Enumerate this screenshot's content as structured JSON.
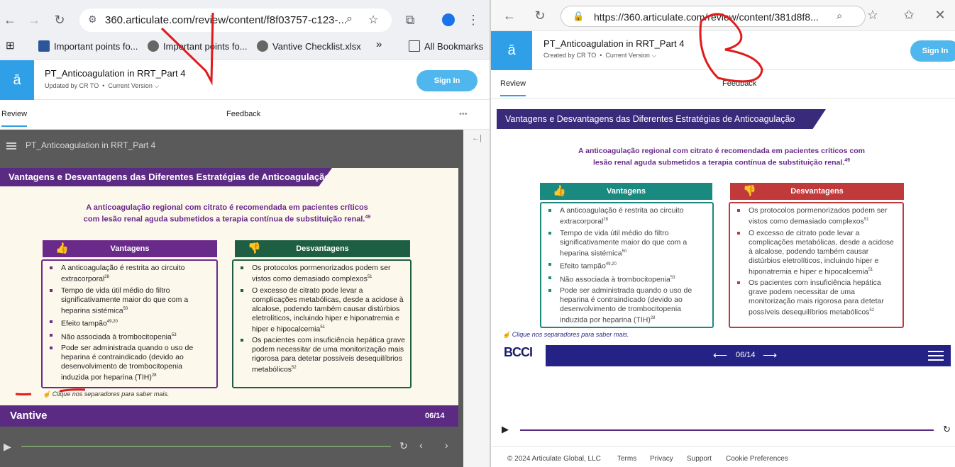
{
  "left": {
    "url": "360.articulate.com/review/content/f8f03757-c123-...",
    "bookmarks": [
      {
        "label": "Important points fo...",
        "icon": "word-doc-icon"
      },
      {
        "label": "Important points fo...",
        "icon": "globe-icon"
      },
      {
        "label": "Vantive Checklist.xlsx",
        "icon": "globe-icon"
      }
    ],
    "more_bookmarks": "»",
    "all_bookmarks": "All Bookmarks",
    "course_title": "PT_Anticoagulation in RRT_Part 4",
    "subtitle_author": "Updated by CR TO",
    "subtitle_version": "Current Version ⌵",
    "sign_in": "Sign In",
    "tab_review": "Review",
    "tab_feedback": "Feedback",
    "more": "•••",
    "player_title": "PT_Anticoagulation in RRT_Part 4",
    "collapse": "←|",
    "brand": "Vantive",
    "page": "06/14",
    "colors": {
      "banner": "#5b2a82",
      "advantages": "#6a2a8a",
      "disadvantages": "#1e5e43"
    }
  },
  "right": {
    "url": "https://360.articulate.com/review/content/381d8f8...",
    "course_title": "PT_Anticoagulation in RRT_Part 4",
    "subtitle_author": "Created by CR TO",
    "subtitle_version": "Current Version ⌵",
    "sign_in": "Sign In",
    "tab_review": "Review",
    "tab_feedback": "Feedback",
    "brand": "BCCI",
    "page": "06/14",
    "colors": {
      "banner": "#3a2a7a",
      "advantages": "#1a8a80",
      "disadvantages": "#c0393b",
      "footer": "#242284"
    }
  },
  "slide": {
    "title": "Vantagens e Desvantagens das Diferentes Estratégias de Anticoagulação",
    "headline_line1": "A anticoagulação regional com citrato é recomendada em pacientes críticos",
    "headline_line2": "com lesão renal aguda submetidos a terapia contínua de substituição renal.",
    "headline_right_line1": "A anticoagulação regional com citrato é recomendada em pacientes críticos com",
    "headline_right_line2": "lesão renal aguda submetidos a terapia contínua de substituição renal.",
    "headline_ref": "49",
    "advantages_label": "Vantagens",
    "disadvantages_label": "Desvantagens",
    "advantages": [
      {
        "text": "A anticoagulação é restrita ao circuito extracorporal",
        "ref": "28"
      },
      {
        "text": "Tempo de vida útil médio do filtro significativamente maior do que com a heparina sistémica",
        "ref": "50"
      },
      {
        "text": "Efeito tampão",
        "ref": "49,20"
      },
      {
        "text": "Não associada à trombocitopenia",
        "ref": "53"
      },
      {
        "text": "Pode ser administrada quando o uso de heparina é contraindicado (devido ao desenvolvimento de trombocitopenia induzida por heparina (TIH)",
        "ref": "28"
      }
    ],
    "disadvantages": [
      {
        "text": "Os protocolos pormenorizados podem ser vistos como demasiado complexos",
        "ref": "51"
      },
      {
        "text": "O excesso de citrato pode levar a complicações metabólicas, desde a acidose à alcalose, podendo também causar distúrbios eletrolíticos, incluindo hiper e hiponatremia e hiper e hipocalcemia",
        "ref": "51"
      },
      {
        "text": "Os pacientes com insuficiência hepática grave podem necessitar de uma monitorização mais rigorosa para detetar possíveis desequilíbrios metabólicos",
        "ref": "52"
      }
    ],
    "hint": "Clique nos separadores para saber mais."
  },
  "footer_links": [
    "© 2024 Articulate Global, LLC",
    "Terms",
    "Privacy",
    "Support",
    "Cookie Preferences"
  ]
}
